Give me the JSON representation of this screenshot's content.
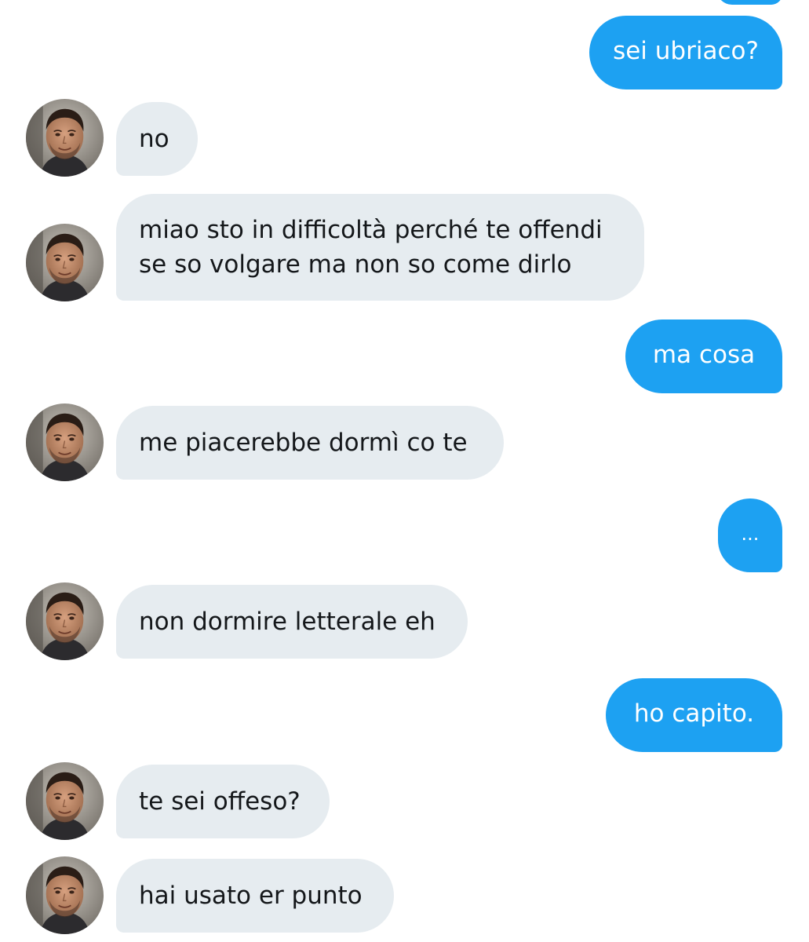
{
  "conversation": {
    "messages": [
      {
        "side": "outgoing",
        "text": "sei ubriaco?"
      },
      {
        "side": "incoming",
        "text": "no"
      },
      {
        "side": "incoming",
        "lines": [
          "miao sto in difficoltà perché te offendi",
          "se so volgare ma non so come dirlo"
        ]
      },
      {
        "side": "outgoing",
        "text": "ma cosa"
      },
      {
        "side": "incoming",
        "text": "me piacerebbe dormì co te"
      },
      {
        "side": "outgoing",
        "text": "..."
      },
      {
        "side": "incoming",
        "text": "non dormire letterale eh"
      },
      {
        "side": "outgoing",
        "text": "ho capito."
      },
      {
        "side": "incoming",
        "text": "te sei offeso?"
      },
      {
        "side": "incoming",
        "text": "hai usato er punto"
      }
    ]
  },
  "colors": {
    "outgoing_bubble": "#1da1f2",
    "incoming_bubble": "#e6ecf0",
    "incoming_text": "#14171a",
    "outgoing_text": "#ffffff",
    "background": "#ffffff"
  },
  "icons": {
    "avatar": "contact-avatar-photo"
  }
}
